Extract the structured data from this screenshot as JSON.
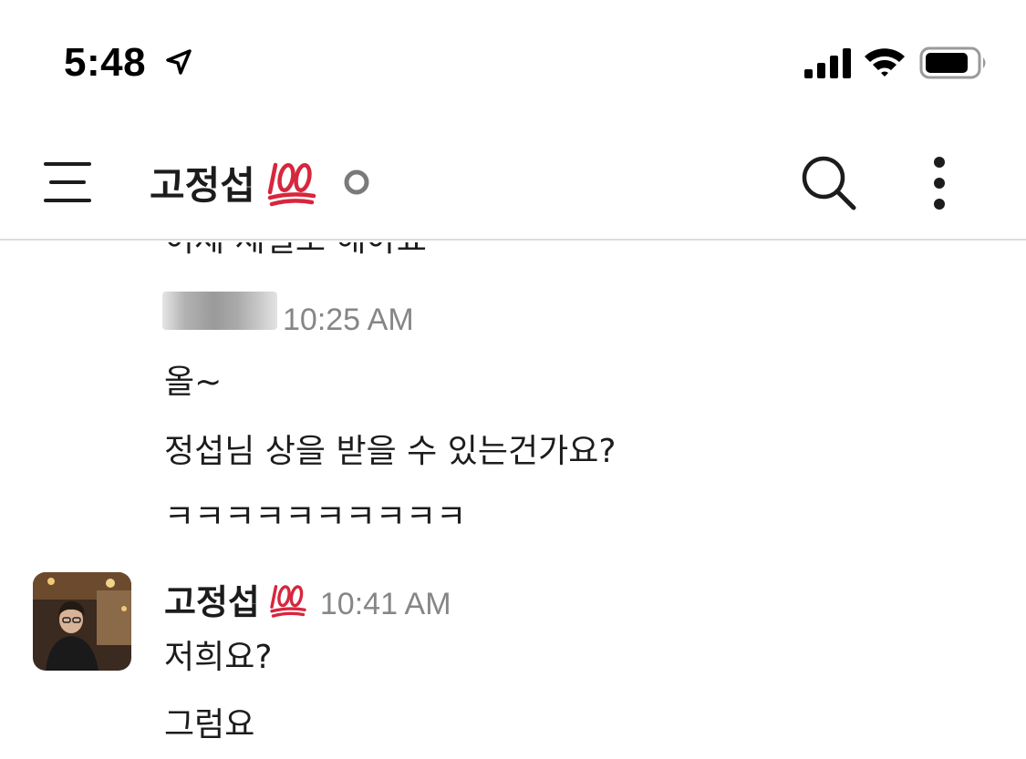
{
  "status_bar": {
    "time": "5:48",
    "icons": [
      "location-arrow-icon",
      "cellular-signal-icon",
      "wifi-icon",
      "battery-icon"
    ]
  },
  "header": {
    "channel_name": "고정섭",
    "status_emoji": "100-emoji-icon",
    "presence": "away",
    "icons": [
      "hamburger-menu-icon",
      "search-icon",
      "more-vertical-icon"
    ]
  },
  "messages": {
    "cut_off_text": "이제 제일로 해야죠",
    "groups": [
      {
        "sender": "",
        "sender_blurred": true,
        "timestamp": "10:25 AM",
        "lines": [
          "올~",
          "정섭님 상을 받을 수 있는건가요?",
          "ㅋㅋㅋㅋㅋㅋㅋㅋㅋㅋ"
        ]
      },
      {
        "sender": "고정섭",
        "status_emoji": "100-emoji-icon",
        "timestamp": "10:41 AM",
        "lines": [
          "저희요?",
          "그럼요"
        ]
      }
    ]
  },
  "colors": {
    "text": "#1d1c1d",
    "timestamp": "#868686",
    "emoji_red": "#d7263d",
    "divider": "#dcdcdc"
  }
}
